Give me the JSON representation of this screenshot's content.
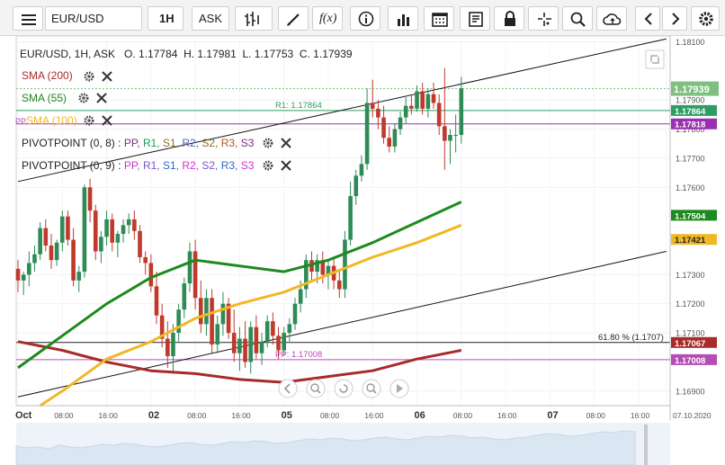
{
  "toolbar": {
    "symbol": "EUR/USD",
    "timeframe": "1H",
    "price_type": "ASK",
    "icons": [
      "menu-icon",
      "dropdown-arrow-icon",
      "bar-style-icon",
      "draw-line-icon",
      "function-icon",
      "info-icon",
      "indicators-icon",
      "calendar-icon",
      "news-icon",
      "lock-icon",
      "crosshair-icon",
      "zoom-icon",
      "cloud-save-icon",
      "prev-icon",
      "next-icon",
      "settings-icon"
    ]
  },
  "header": {
    "ohlc": "EUR/USD, 1H, ASK   O. 1.17784  H. 1.17981  L. 1.17753  C. 1.17939"
  },
  "legend": {
    "sma200": "SMA (200)",
    "sma55": "SMA (55)",
    "sma100": "SMA (100)",
    "sma100_prefix": "PP",
    "pp_a_name": "PIVOTPOINT (0, 8)",
    "pp_b_name": "PIVOTPOINT (0, 9)",
    "pp_sep": " : ",
    "pp_labels": [
      "PP",
      "R1",
      "S1",
      "R2",
      "S2",
      "R3",
      "S3"
    ],
    "pp_a_colors": [
      "#7b2a7b",
      "#1e9a58",
      "#8a6d2a",
      "#5566bb",
      "#8a6d2a",
      "#aa5a22",
      "#7b2a7b"
    ],
    "pp_b_colors": [
      "#cc33cc",
      "#7755cc",
      "#3366cc",
      "#cc33cc",
      "#7755cc",
      "#3366cc",
      "#cc33cc"
    ],
    "icons": [
      "gear-icon",
      "close-icon"
    ]
  },
  "colors": {
    "sma200": "#a82a2a",
    "sma55": "#1d8a1d",
    "sma100": "#f2b824",
    "up": "#2e8b57",
    "down": "#c0392b",
    "r1": "#2e9c63",
    "pp": "#b64cb6",
    "fib": "#222222"
  },
  "chart_data": {
    "type": "candlestick",
    "symbol": "EUR/USD",
    "timeframe": "1H",
    "price_range": [
      1.1685,
      1.1812
    ],
    "y_ticks": [
      "1.17900",
      "1.17800",
      "1.17700",
      "1.17600",
      "1.17300",
      "1.17200",
      "1.17100",
      "1.16900",
      "1.18100"
    ],
    "y_tick_values": [
      1.179,
      1.178,
      1.177,
      1.176,
      1.173,
      1.172,
      1.171,
      1.169,
      1.181
    ],
    "x_ticks": [
      "Oct",
      "08:00",
      "16:00",
      "02",
      "08:00",
      "16:00",
      "05",
      "08:00",
      "16:00",
      "06",
      "08:00",
      "16:00",
      "07",
      "08:00",
      "16:00",
      "07.10.2020"
    ],
    "x_tick_bars": [
      0,
      8,
      16,
      24,
      32,
      40,
      48,
      56,
      64,
      72,
      80,
      88,
      96,
      104,
      112,
      117
    ],
    "bold_x_ticks": [
      "Oct",
      "02",
      "05",
      "06",
      "07"
    ],
    "candles": [
      [
        1.1732,
        1.1735,
        1.1724,
        1.1728
      ],
      [
        1.1728,
        1.1731,
        1.1723,
        1.173
      ],
      [
        1.173,
        1.1738,
        1.1726,
        1.1734
      ],
      [
        1.1734,
        1.174,
        1.1731,
        1.1737
      ],
      [
        1.1737,
        1.1748,
        1.1735,
        1.1746
      ],
      [
        1.1746,
        1.1749,
        1.1738,
        1.174
      ],
      [
        1.174,
        1.1744,
        1.1732,
        1.1735
      ],
      [
        1.1735,
        1.1742,
        1.1733,
        1.1741
      ],
      [
        1.1741,
        1.1752,
        1.1738,
        1.175
      ],
      [
        1.175,
        1.1752,
        1.174,
        1.1742
      ],
      [
        1.1742,
        1.1746,
        1.1726,
        1.1728
      ],
      [
        1.1728,
        1.1733,
        1.1724,
        1.1731
      ],
      [
        1.1731,
        1.1761,
        1.1729,
        1.176
      ],
      [
        1.176,
        1.1763,
        1.1748,
        1.1752
      ],
      [
        1.1752,
        1.1754,
        1.1735,
        1.1738
      ],
      [
        1.1738,
        1.1745,
        1.1734,
        1.1743
      ],
      [
        1.1743,
        1.1752,
        1.174,
        1.1749
      ],
      [
        1.1749,
        1.1751,
        1.1738,
        1.1741
      ],
      [
        1.1741,
        1.1745,
        1.1736,
        1.1744
      ],
      [
        1.1744,
        1.1749,
        1.1741,
        1.1747
      ],
      [
        1.1747,
        1.1751,
        1.1744,
        1.1749
      ],
      [
        1.1749,
        1.1752,
        1.1742,
        1.1745
      ],
      [
        1.1745,
        1.1747,
        1.1734,
        1.1736
      ],
      [
        1.1736,
        1.1738,
        1.173,
        1.1734
      ],
      [
        1.1734,
        1.1737,
        1.1724,
        1.1726
      ],
      [
        1.1726,
        1.1731,
        1.1713,
        1.1716
      ],
      [
        1.1716,
        1.172,
        1.1705,
        1.1708
      ],
      [
        1.1708,
        1.1714,
        1.1698,
        1.1702
      ],
      [
        1.1702,
        1.1713,
        1.1696,
        1.171
      ],
      [
        1.171,
        1.172,
        1.1707,
        1.1718
      ],
      [
        1.1718,
        1.1729,
        1.1715,
        1.1727
      ],
      [
        1.1727,
        1.1741,
        1.1724,
        1.1738
      ],
      [
        1.1738,
        1.1742,
        1.1718,
        1.1722
      ],
      [
        1.1722,
        1.1728,
        1.171,
        1.1713
      ],
      [
        1.1713,
        1.1725,
        1.1709,
        1.1722
      ],
      [
        1.1722,
        1.1725,
        1.1703,
        1.1706
      ],
      [
        1.1706,
        1.1716,
        1.1703,
        1.1713
      ],
      [
        1.1713,
        1.1724,
        1.1709,
        1.172
      ],
      [
        1.172,
        1.1722,
        1.1708,
        1.171
      ],
      [
        1.171,
        1.1718,
        1.17,
        1.1703
      ],
      [
        1.1703,
        1.1712,
        1.1697,
        1.1708
      ],
      [
        1.1708,
        1.1714,
        1.1698,
        1.17
      ],
      [
        1.17,
        1.1714,
        1.1696,
        1.1712
      ],
      [
        1.1712,
        1.1716,
        1.1701,
        1.1703
      ],
      [
        1.1703,
        1.171,
        1.1699,
        1.1707
      ],
      [
        1.1707,
        1.1716,
        1.1705,
        1.1714
      ],
      [
        1.1714,
        1.1717,
        1.1706,
        1.1709
      ],
      [
        1.1709,
        1.1712,
        1.1701,
        1.1704
      ],
      [
        1.1704,
        1.1712,
        1.1702,
        1.171
      ],
      [
        1.171,
        1.1715,
        1.1707,
        1.1713
      ],
      [
        1.1713,
        1.1722,
        1.1711,
        1.172
      ],
      [
        1.172,
        1.1728,
        1.1717,
        1.1725
      ],
      [
        1.1725,
        1.1737,
        1.1722,
        1.1735
      ],
      [
        1.1735,
        1.1738,
        1.1728,
        1.1731
      ],
      [
        1.1731,
        1.1737,
        1.1727,
        1.1735
      ],
      [
        1.1735,
        1.1738,
        1.1727,
        1.173
      ],
      [
        1.173,
        1.1735,
        1.1725,
        1.1733
      ],
      [
        1.1733,
        1.1736,
        1.1725,
        1.1728
      ],
      [
        1.1728,
        1.1732,
        1.1722,
        1.1725
      ],
      [
        1.1725,
        1.1745,
        1.1722,
        1.1742
      ],
      [
        1.1742,
        1.1762,
        1.174,
        1.1757
      ],
      [
        1.1757,
        1.1766,
        1.1754,
        1.1764
      ],
      [
        1.1764,
        1.1771,
        1.1762,
        1.1768
      ],
      [
        1.1768,
        1.1794,
        1.1766,
        1.1789
      ],
      [
        1.1789,
        1.1797,
        1.1784,
        1.1787
      ],
      [
        1.1787,
        1.179,
        1.178,
        1.1784
      ],
      [
        1.1784,
        1.1788,
        1.1775,
        1.1777
      ],
      [
        1.1777,
        1.1781,
        1.1772,
        1.1774
      ],
      [
        1.1774,
        1.1782,
        1.1772,
        1.178
      ],
      [
        1.178,
        1.1786,
        1.1778,
        1.1784
      ],
      [
        1.1784,
        1.1791,
        1.1782,
        1.1788
      ],
      [
        1.1788,
        1.1792,
        1.1785,
        1.1787
      ],
      [
        1.1787,
        1.1795,
        1.1786,
        1.1793
      ],
      [
        1.1793,
        1.1796,
        1.1785,
        1.1787
      ],
      [
        1.1787,
        1.1794,
        1.1784,
        1.1792
      ],
      [
        1.1792,
        1.1796,
        1.1787,
        1.1789
      ],
      [
        1.1789,
        1.1792,
        1.1778,
        1.1781
      ],
      [
        1.1781,
        1.1801,
        1.1766,
        1.1776
      ],
      [
        1.1776,
        1.178,
        1.1768,
        1.1778
      ],
      [
        1.1778,
        1.1785,
        1.1772,
        1.1778
      ],
      [
        1.1778,
        1.1798,
        1.1775,
        1.1794
      ]
    ],
    "sma200": [
      [
        0,
        1.1707
      ],
      [
        8,
        1.1704
      ],
      [
        16,
        1.17
      ],
      [
        24,
        1.1697
      ],
      [
        32,
        1.1696
      ],
      [
        40,
        1.1694
      ],
      [
        48,
        1.1693
      ],
      [
        56,
        1.1695
      ],
      [
        64,
        1.1697
      ],
      [
        72,
        1.1701
      ],
      [
        80,
        1.1704
      ]
    ],
    "sma55": [
      [
        0,
        1.1698
      ],
      [
        8,
        1.1709
      ],
      [
        16,
        1.172
      ],
      [
        24,
        1.1729
      ],
      [
        32,
        1.1735
      ],
      [
        40,
        1.1733
      ],
      [
        48,
        1.1731
      ],
      [
        56,
        1.1735
      ],
      [
        64,
        1.1741
      ],
      [
        72,
        1.1748
      ],
      [
        80,
        1.1755
      ]
    ],
    "sma100": [
      [
        4,
        1.1685
      ],
      [
        8,
        1.169
      ],
      [
        16,
        1.1701
      ],
      [
        24,
        1.1707
      ],
      [
        32,
        1.1715
      ],
      [
        40,
        1.172
      ],
      [
        48,
        1.1724
      ],
      [
        56,
        1.173
      ],
      [
        64,
        1.1736
      ],
      [
        72,
        1.1741
      ],
      [
        80,
        1.1747
      ]
    ],
    "trend_lines": [
      {
        "from": [
          0,
          1.1762
        ],
        "to": [
          117,
          1.1811
        ]
      },
      {
        "from": [
          0,
          1.1688
        ],
        "to": [
          117,
          1.1738
        ]
      }
    ],
    "horizontal_levels": [
      {
        "name": "R1",
        "value": 1.17864,
        "label": "R1: 1.17864",
        "badge": "1.17864",
        "color": "#2e9c63"
      },
      {
        "name": "purple",
        "value": 1.17818,
        "label": "",
        "badge": "1.17818",
        "color": "#9b2fb3"
      },
      {
        "name": "SMA55",
        "value": 1.17504,
        "label": "",
        "badge": "1.17504",
        "color": "#1d8a1d"
      },
      {
        "name": "SMA100",
        "value": 1.17421,
        "label": "",
        "badge": "1.17421",
        "color": "#f2b824"
      },
      {
        "name": "Fib",
        "value": 1.17067,
        "label": "61.80 % (1.1707)",
        "badge": "1.17067",
        "color": "#a82a2a"
      },
      {
        "name": "PP",
        "value": 1.17008,
        "label": "PP: 1.17008",
        "badge": "1.17008",
        "color": "#b64cb6"
      }
    ],
    "last_price": 1.17939,
    "last_price_label": "1.17939",
    "last_price_color": "#7fbf7f"
  },
  "footer": {
    "nav_icons": [
      "scroll-left-icon",
      "zoom-out-icon",
      "reset-icon",
      "zoom-in-icon",
      "play-icon"
    ]
  }
}
